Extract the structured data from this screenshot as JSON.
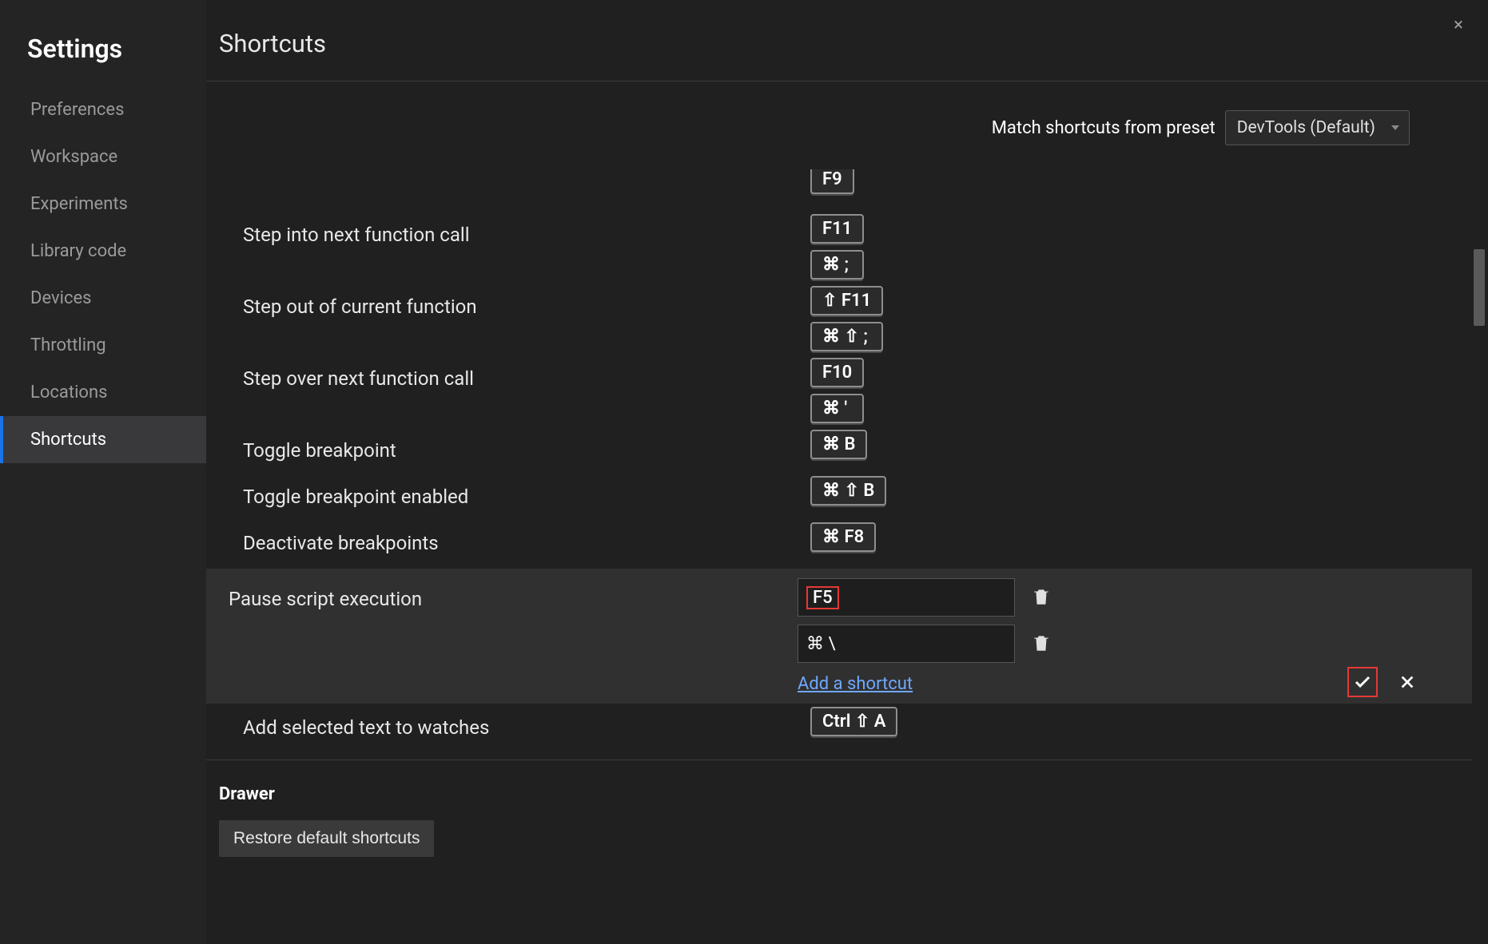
{
  "sidebar": {
    "title": "Settings",
    "items": [
      {
        "label": "Preferences",
        "active": false
      },
      {
        "label": "Workspace",
        "active": false
      },
      {
        "label": "Experiments",
        "active": false
      },
      {
        "label": "Library code",
        "active": false
      },
      {
        "label": "Devices",
        "active": false
      },
      {
        "label": "Throttling",
        "active": false
      },
      {
        "label": "Locations",
        "active": false
      },
      {
        "label": "Shortcuts",
        "active": true
      }
    ]
  },
  "main": {
    "title": "Shortcuts",
    "close_label": "×",
    "preset_label": "Match shortcuts from preset",
    "preset_value": "DevTools (Default)"
  },
  "rows": {
    "step_partial": {
      "key": "F9"
    },
    "step_into": {
      "label": "Step into next function call",
      "keys": [
        "F11",
        "⌘ ;"
      ]
    },
    "step_out": {
      "label": "Step out of current function",
      "keys": [
        "⇧ F11",
        "⌘ ⇧ ;"
      ]
    },
    "step_over": {
      "label": "Step over next function call",
      "keys": [
        "F10",
        "⌘ '"
      ]
    },
    "toggle_bp": {
      "label": "Toggle breakpoint",
      "keys": [
        "⌘ B"
      ]
    },
    "toggle_bp_enabled": {
      "label": "Toggle breakpoint enabled",
      "keys": [
        "⌘ ⇧ B"
      ]
    },
    "deactivate_bp": {
      "label": "Deactivate breakpoints",
      "keys": [
        "⌘ F8"
      ]
    },
    "watches": {
      "label": "Add selected text to watches",
      "keys": [
        "Ctrl ⇧ A"
      ]
    }
  },
  "editing_row": {
    "label": "Pause script execution",
    "input1": "F5",
    "input2": "⌘ \\",
    "add_link": "Add a shortcut"
  },
  "footer": {
    "section": "Drawer",
    "restore_label": "Restore default shortcuts"
  }
}
